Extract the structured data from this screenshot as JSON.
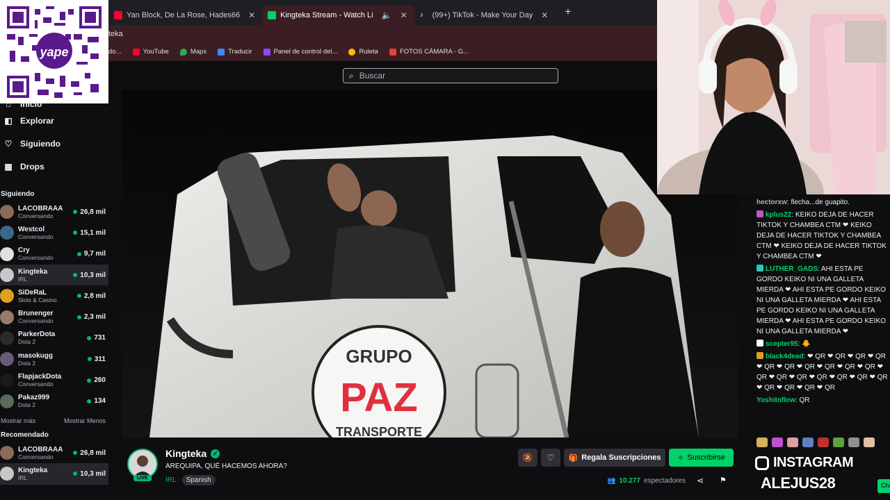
{
  "browser": {
    "tabs": [
      {
        "label": "Yan Block, De La Rose, Hades66",
        "active": false,
        "fav_color": "#ff0033"
      },
      {
        "label": "Kingteka Stream - Watch Li",
        "active": true,
        "fav_color": "#00d26a"
      },
      {
        "label": "(99+) TikTok - Make Your Day",
        "active": false,
        "fav_color": "#1f1f23"
      }
    ],
    "address_fragment": "teka",
    "bookmarks": [
      {
        "label": "do...",
        "color": "#777"
      },
      {
        "label": "YouTube",
        "color": "#ff0033"
      },
      {
        "label": "Maps",
        "color": "#34a853"
      },
      {
        "label": "Traducir",
        "color": "#4285f4"
      },
      {
        "label": "Panel de control del...",
        "color": "#9146ff"
      },
      {
        "label": "Ruleta",
        "color": "#fbbc05"
      },
      {
        "label": "FOTOS CÁMARA - G...",
        "color": "#ea4335"
      }
    ]
  },
  "qr_overlay": {
    "brand": "yape"
  },
  "sidebar": {
    "nav": [
      {
        "label": "Inicio",
        "icon": "home-icon",
        "glyph": "⌂"
      },
      {
        "label": "Explorar",
        "icon": "explore-icon",
        "glyph": "◧"
      },
      {
        "label": "Siguiendo",
        "icon": "heart-icon",
        "glyph": "♡"
      },
      {
        "label": "Drops",
        "icon": "drops-icon",
        "glyph": "▦"
      }
    ],
    "following_title": "Siguiendo",
    "following": [
      {
        "name": "LACOBRAAA",
        "category": "Conversando",
        "viewers": "26,8 mil",
        "color": "#8a6a5a"
      },
      {
        "name": "Westcol",
        "category": "Conversando",
        "viewers": "15,1 mil",
        "color": "#3a6a8a"
      },
      {
        "name": "Cry",
        "category": "Conversando",
        "viewers": "9,7 mil",
        "color": "#e0e0e0"
      },
      {
        "name": "Kingteka",
        "category": "IRL",
        "viewers": "10,3 mil",
        "color": "#c8c8c8"
      },
      {
        "name": "SiDeRaL",
        "category": "Slots & Casino",
        "viewers": "2,8 mil",
        "color": "#e0a020"
      },
      {
        "name": "Brunenger",
        "category": "Conversando",
        "viewers": "2,3 mil",
        "color": "#9a7a6a"
      },
      {
        "name": "ParkerDota",
        "category": "Dota 2",
        "viewers": "731",
        "color": "#2a2a2a"
      },
      {
        "name": "masokugg",
        "category": "Dota 2",
        "viewers": "311",
        "color": "#6a5a7a"
      },
      {
        "name": "FlapjackDota",
        "category": "Conversando",
        "viewers": "260",
        "color": "#1a1a1a"
      },
      {
        "name": "Pakaz999",
        "category": "Dota 2",
        "viewers": "134",
        "color": "#5a6a5a"
      }
    ],
    "show_more": "Mostrar más",
    "show_less": "Mostrar Menos",
    "recommended_title": "Recomendado",
    "recommended": [
      {
        "name": "LACOBRAAA",
        "category": "Conversando",
        "viewers": "26,8 mil",
        "color": "#8a6a5a"
      },
      {
        "name": "Kingteka",
        "category": "IRL",
        "viewers": "10,3 mil",
        "color": "#c8c8c8"
      }
    ]
  },
  "search": {
    "placeholder": "Buscar"
  },
  "video": {
    "truck_text_1": "GRUPO",
    "truck_text_2": "PAZ",
    "truck_text_3": "TRANSPORTE"
  },
  "channel": {
    "name": "Kingteka",
    "live_label": "LIVE",
    "stream_title": "AREQUIPA, QUÉ HACEMOS AHORA?",
    "category": "IRL",
    "tag": "Spanish",
    "gift_label": "Regala Suscripciones",
    "subscribe_label": "Suscribirse",
    "viewer_count": "10.277",
    "viewers_suffix": "espectadores"
  },
  "chat": {
    "messages": [
      {
        "user": "hectorxw",
        "color": "#b0b0b0",
        "badge": "",
        "text": "flecha...de guapito."
      },
      {
        "user": "kplus22",
        "color": "#00d26a",
        "badge": "#c058c0",
        "text": "KEIKO DEJA DE HACER TIKTOK Y CHAMBEA CTM ❤ KEIKO DEJA DE HACER TIKTOK Y CHAMBEA CTM ❤ KEIKO DEJA DE HACER TIKTOK Y CHAMBEA CTM ❤"
      },
      {
        "user": "LUTHER_GADS",
        "color": "#00d26a",
        "badge": "#30c0c0",
        "text": "AHI ESTA PE GORDO KEIKO NI UNA GALLETA MIERDA ❤ AHI ESTA PE GORDO KEIKO NI UNA GALLETA MIERDA ❤ AHI ESTA PE GORDO KEIKO NI UNA GALLETA MIERDA ❤ AHI ESTA PE GORDO KEIKO NI UNA GALLETA MIERDA ❤"
      },
      {
        "user": "scepter95",
        "color": "#00d26a",
        "badge": "#ffffff",
        "text": "🐥"
      },
      {
        "user": "black4dead",
        "color": "#00d26a",
        "badge": "#e0a020",
        "text": "❤ QR ❤ QR ❤ QR ❤ QR ❤ QR ❤ QR ❤ QR ❤ QR ❤ QR ❤ QR ❤ QR ❤ QR ❤ QR ❤ QR ❤ QR ❤ QR ❤ QR ❤ QR ❤ QR ❤ QR ❤ QR"
      },
      {
        "user": "Yoshitoflow",
        "color": "#00d26a",
        "badge": "",
        "text": "QR"
      }
    ],
    "overlay_instagram": "INSTAGRAM",
    "overlay_handle": "ALEJUS28",
    "chat_button": "Cha"
  }
}
